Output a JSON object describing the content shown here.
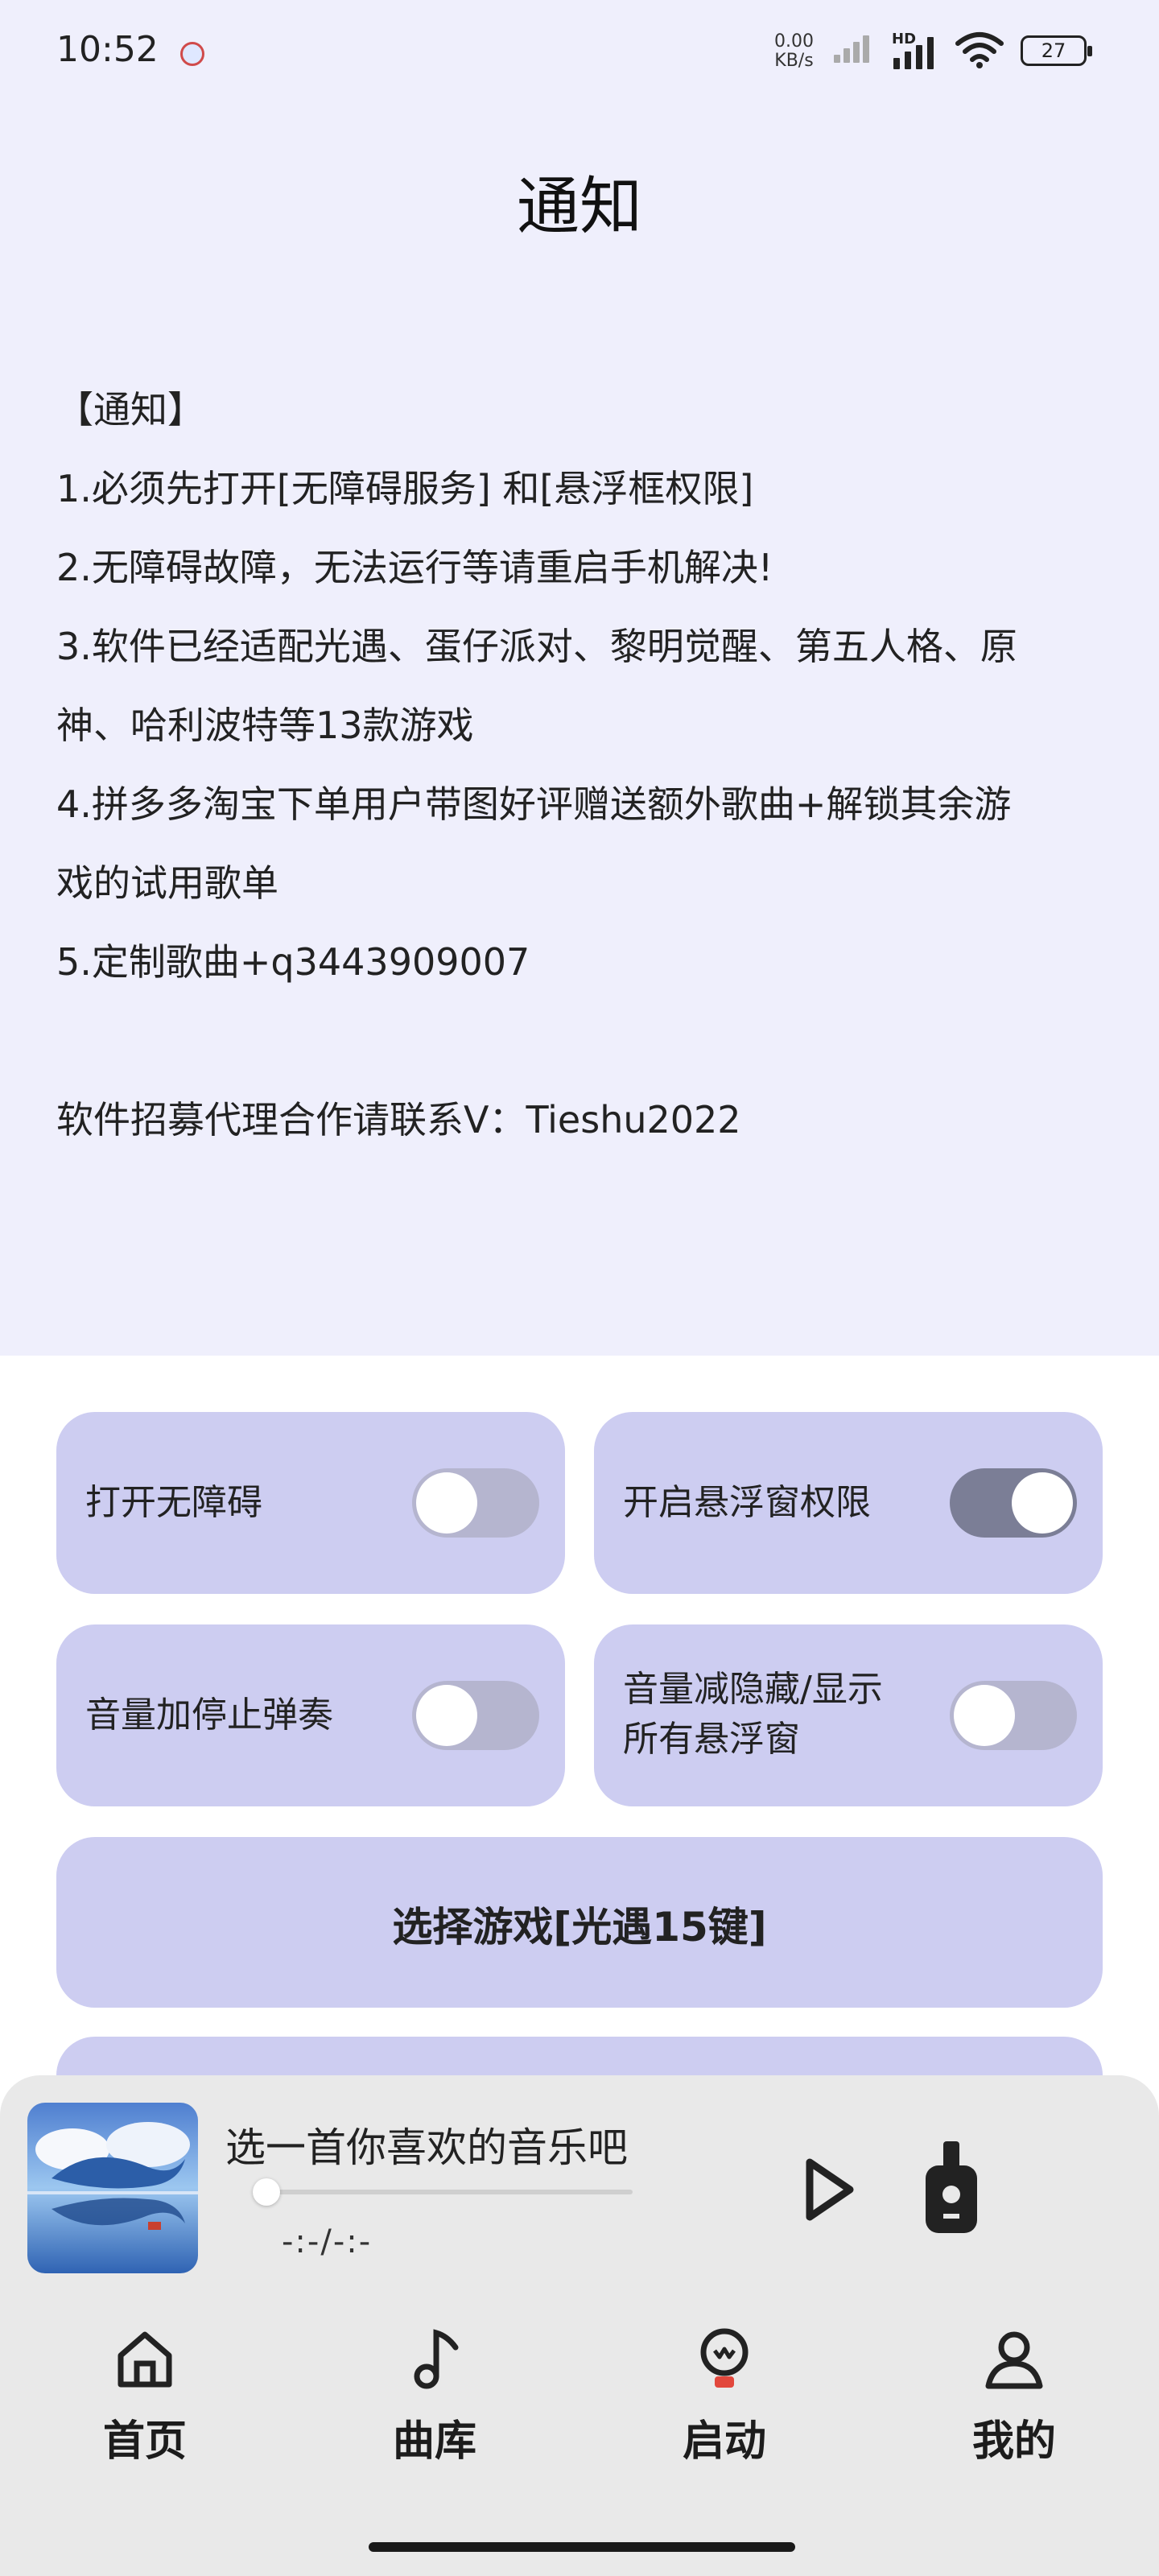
{
  "status_bar": {
    "time": "10:52",
    "net_speed_value": "0.00",
    "net_speed_unit": "KB/s",
    "hd_label": "HD",
    "battery_level": "27"
  },
  "notice": {
    "title": "通知",
    "lines": [
      "【通知】",
      "1.必须先打开[无障碍服务] 和[悬浮框权限]",
      "2.无障碍故障，无法运行等请重启手机解决!",
      "3.软件已经适配光遇、蛋仔派对、黎明觉醒、第五人格、原",
      "神、哈利波特等13款游戏",
      "4.拼多多淘宝下单用户带图好评赠送额外歌曲+解锁其余游",
      "戏的试用歌单",
      "5.定制歌曲+q3443909007"
    ],
    "contact": "软件招募代理合作请联系V：Tieshu2022"
  },
  "controls": {
    "accessibility": {
      "label": "打开无障碍",
      "enabled": false
    },
    "floating_window": {
      "label": "开启悬浮窗权限",
      "enabled": true
    },
    "volume_up_stop": {
      "label": "音量加停止弹奏",
      "enabled": false
    },
    "volume_down_toggle": {
      "label_line1": "音量减隐藏/显示",
      "label_line2": "所有悬浮窗",
      "enabled": false
    },
    "select_game": "选择游戏[光遇15键]"
  },
  "player": {
    "title": "选一首你喜欢的音乐吧",
    "time": "-:-/-:-",
    "progress": 0
  },
  "nav": {
    "home": "首页",
    "library": "曲库",
    "launch": "启动",
    "mine": "我的"
  },
  "icons": [
    "notification-app-icon",
    "signal-icon",
    "wifi-icon",
    "battery-icon",
    "play-icon",
    "guitar-icon",
    "home-icon",
    "music-note-icon",
    "lightbulb-icon",
    "person-icon"
  ],
  "colors": {
    "notice_bg": "#efeffc",
    "card_bg": "#cdcdf1",
    "toggle_off": "#b5b5cf",
    "toggle_on": "#7b7e96",
    "player_bg": "#e9e9e9"
  }
}
